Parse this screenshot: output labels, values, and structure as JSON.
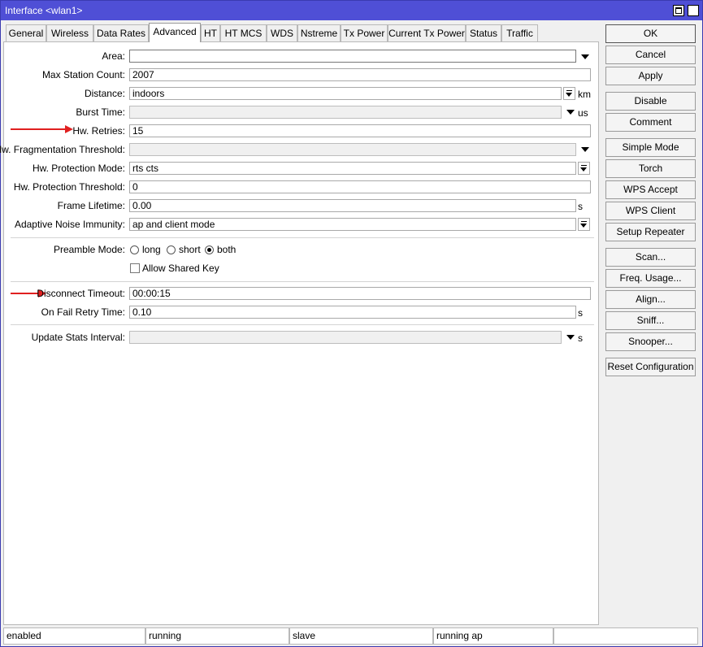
{
  "window": {
    "title": "Interface <wlan1>"
  },
  "tabs": [
    {
      "label": "General"
    },
    {
      "label": "Wireless"
    },
    {
      "label": "Data Rates"
    },
    {
      "label": "Advanced"
    },
    {
      "label": "HT"
    },
    {
      "label": "HT MCS"
    },
    {
      "label": "WDS"
    },
    {
      "label": "Nstreme"
    },
    {
      "label": "Tx Power"
    },
    {
      "label": "Current Tx Power"
    },
    {
      "label": "Status"
    },
    {
      "label": "Traffic"
    }
  ],
  "active_tab": "Advanced",
  "form": {
    "area": {
      "label": "Area:",
      "value": ""
    },
    "max_station_count": {
      "label": "Max Station Count:",
      "value": "2007"
    },
    "distance": {
      "label": "Distance:",
      "value": "indoors",
      "unit": "km"
    },
    "burst_time": {
      "label": "Burst Time:",
      "value": "",
      "unit": "us"
    },
    "hw_retries": {
      "label": "Hw. Retries:",
      "value": "15"
    },
    "hw_fragmentation_threshold": {
      "label": "Hw. Fragmentation Threshold:",
      "value": ""
    },
    "hw_protection_mode": {
      "label": "Hw. Protection Mode:",
      "value": "rts cts"
    },
    "hw_protection_threshold": {
      "label": "Hw. Protection Threshold:",
      "value": "0"
    },
    "frame_lifetime": {
      "label": "Frame Lifetime:",
      "value": "0.00",
      "unit": "s"
    },
    "adaptive_noise_immunity": {
      "label": "Adaptive Noise Immunity:",
      "value": "ap and client mode"
    },
    "preamble_mode": {
      "label": "Preamble Mode:",
      "options": [
        "long",
        "short",
        "both"
      ],
      "selected": "both"
    },
    "allow_shared_key": {
      "label": "Allow Shared Key",
      "checked": false
    },
    "disconnect_timeout": {
      "label": "Disconnect Timeout:",
      "value": "00:00:15"
    },
    "on_fail_retry_time": {
      "label": "On Fail Retry Time:",
      "value": "0.10",
      "unit": "s"
    },
    "update_stats_interval": {
      "label": "Update Stats Interval:",
      "value": "",
      "unit": "s"
    }
  },
  "buttons": [
    {
      "label": "OK"
    },
    {
      "label": "Cancel"
    },
    {
      "label": "Apply"
    },
    {
      "label": "Disable"
    },
    {
      "label": "Comment"
    },
    {
      "label": "Simple Mode"
    },
    {
      "label": "Torch"
    },
    {
      "label": "WPS Accept"
    },
    {
      "label": "WPS Client"
    },
    {
      "label": "Setup Repeater"
    },
    {
      "label": "Scan..."
    },
    {
      "label": "Freq. Usage..."
    },
    {
      "label": "Align..."
    },
    {
      "label": "Sniff..."
    },
    {
      "label": "Snooper..."
    },
    {
      "label": "Reset Configuration"
    }
  ],
  "status_bar": [
    "enabled",
    "running",
    "slave",
    "running ap",
    ""
  ],
  "colors": {
    "titlebar": "#4f4fd6",
    "annotation_arrow": "#e02020"
  },
  "icons": [
    "restore-icon",
    "close-icon",
    "dropdown-arrow-icon",
    "red-arrow-annotation-icon"
  ]
}
